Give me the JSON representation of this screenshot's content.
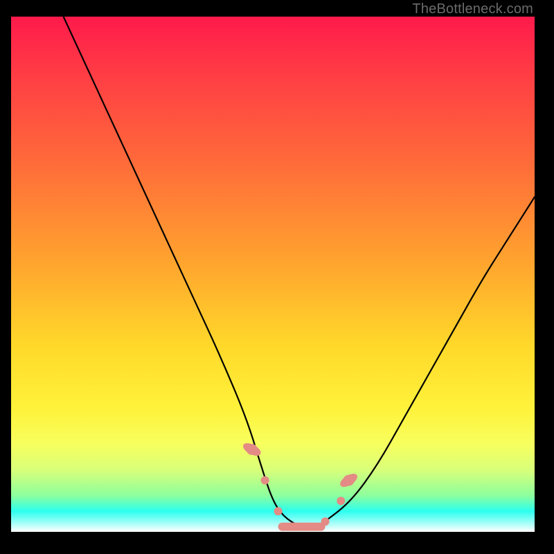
{
  "watermark": {
    "text": "TheBottleneck.com"
  },
  "colors": {
    "frame": "#000000",
    "curve": "#000000",
    "marker": "#e38b84",
    "gradient_stops": [
      "#ff1a4b",
      "#ff3f44",
      "#ff6a3a",
      "#ffa52e",
      "#ffd92a",
      "#fff23a",
      "#f7ff5e",
      "#d8ff7a",
      "#8cff9e",
      "#2bffef",
      "#ffffff"
    ]
  },
  "chart_data": {
    "type": "line",
    "title": "",
    "xlabel": "",
    "ylabel": "",
    "xlim": [
      0,
      100
    ],
    "ylim": [
      0,
      100
    ],
    "grid": false,
    "legend": false,
    "series": [
      {
        "name": "bottleneck-curve",
        "x": [
          10,
          15,
          20,
          25,
          30,
          35,
          40,
          45,
          48,
          50,
          52,
          55,
          58,
          60,
          65,
          70,
          75,
          80,
          85,
          90,
          95,
          100
        ],
        "y": [
          100,
          89,
          78,
          67,
          56,
          45,
          34,
          22,
          12,
          6,
          3,
          1,
          1,
          2,
          6,
          13,
          22,
          31,
          40,
          49,
          57,
          65
        ]
      }
    ],
    "markers": {
      "name": "highlight-dots",
      "color": "#e38b84",
      "x": [
        46,
        48.5,
        51,
        54,
        57,
        60,
        63,
        64.5
      ],
      "y": [
        16,
        10,
        4,
        1,
        1,
        2,
        6,
        10
      ]
    }
  }
}
